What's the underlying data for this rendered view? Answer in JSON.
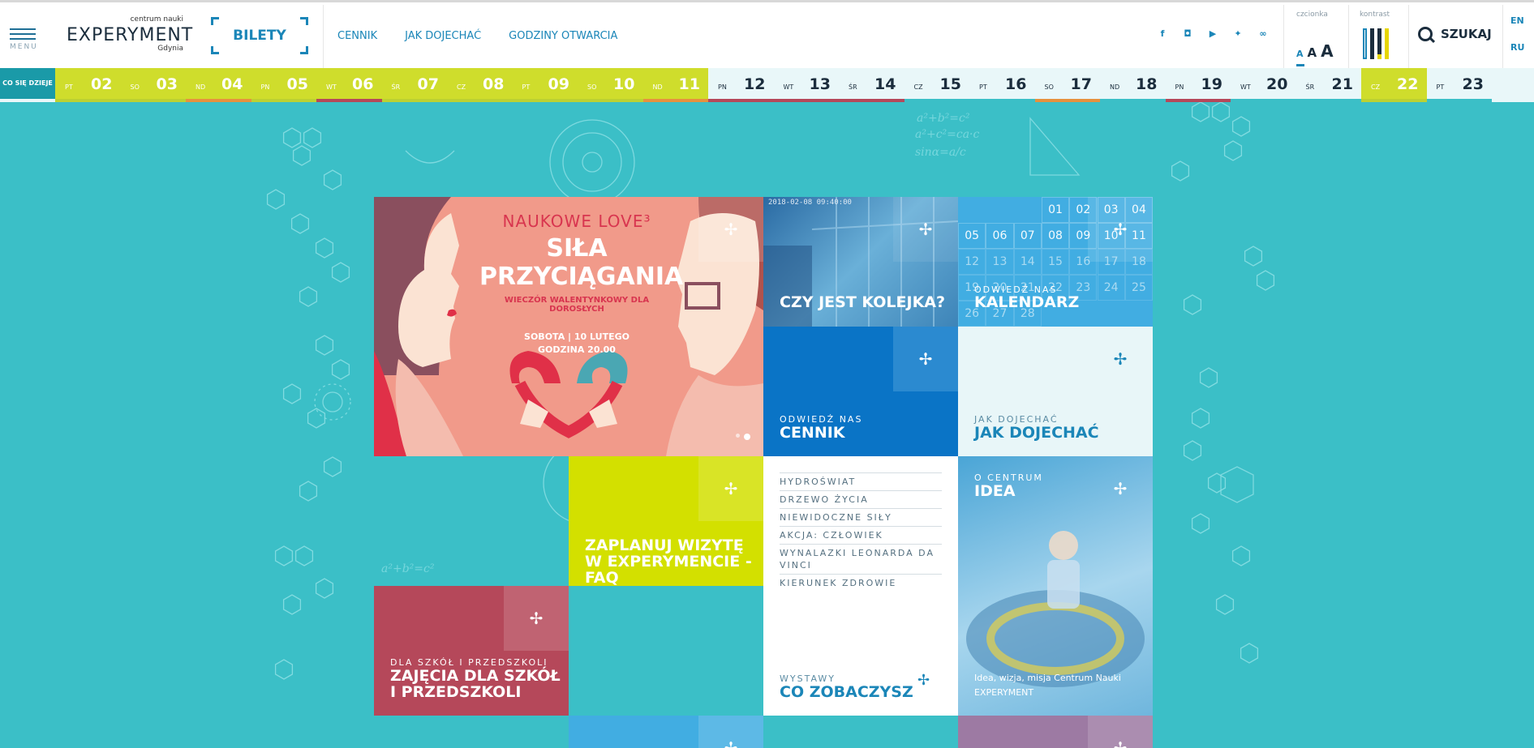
{
  "header": {
    "menu_label": "MENU",
    "logo": {
      "top": "centrum nauki",
      "main": "EXPERYMENT",
      "sub": "Gdynia"
    },
    "tickets": "BILETY",
    "nav": [
      "CENNIK",
      "JAK DOJECHAĆ",
      "GODZINY OTWARCIA"
    ],
    "social_icons": [
      "facebook-icon",
      "instagram-icon",
      "youtube-icon",
      "twitter-icon",
      "tripadvisor-icon"
    ],
    "font_label": "czcionka",
    "font_sizes": [
      "A",
      "A",
      "A"
    ],
    "contrast_label": "kontrast",
    "search_label": "SZUKAJ",
    "languages": [
      "EN",
      "RU"
    ]
  },
  "calendar": {
    "label": "CO SIĘ DZIEJE",
    "days": [
      {
        "name": "PT",
        "num": "02",
        "bg": "#cfdd2c",
        "color": "#ffffff",
        "stripe": "#bcd132"
      },
      {
        "name": "SO",
        "num": "03",
        "bg": "#cfdd2c",
        "color": "#ffffff",
        "stripe": "#bcd132"
      },
      {
        "name": "ND",
        "num": "04",
        "bg": "#cfdd2c",
        "color": "#ffffff",
        "stripe": "#e6913e"
      },
      {
        "name": "PN",
        "num": "05",
        "bg": "#cfdd2c",
        "color": "#ffffff",
        "stripe": "#bcd132"
      },
      {
        "name": "WT",
        "num": "06",
        "bg": "#cfdd2c",
        "color": "#ffffff",
        "stripe": "#b5485a"
      },
      {
        "name": "ŚR",
        "num": "07",
        "bg": "#cfdd2c",
        "color": "#ffffff",
        "stripe": "#bcd132"
      },
      {
        "name": "CZ",
        "num": "08",
        "bg": "#cfdd2c",
        "color": "#ffffff",
        "stripe": "#bcd132"
      },
      {
        "name": "PT",
        "num": "09",
        "bg": "#cfdd2c",
        "color": "#ffffff",
        "stripe": "#bcd132"
      },
      {
        "name": "SO",
        "num": "10",
        "bg": "#cfdd2c",
        "color": "#ffffff",
        "stripe": "#bcd132"
      },
      {
        "name": "ND",
        "num": "11",
        "bg": "#cfdd2c",
        "color": "#ffffff",
        "stripe": "#e6913e"
      },
      {
        "name": "PN",
        "num": "12",
        "bg": "#e9f7f9",
        "color": "#1b2d3d",
        "stripe": "#b5485a"
      },
      {
        "name": "WT",
        "num": "13",
        "bg": "#e9f7f9",
        "color": "#1b2d3d",
        "stripe": "#b5485a"
      },
      {
        "name": "ŚR",
        "num": "14",
        "bg": "#e9f7f9",
        "color": "#1b2d3d",
        "stripe": "#b5485a"
      },
      {
        "name": "CZ",
        "num": "15",
        "bg": "#e9f7f9",
        "color": "#1b2d3d",
        "stripe": "#3bbfc7"
      },
      {
        "name": "PT",
        "num": "16",
        "bg": "#e9f7f9",
        "color": "#1b2d3d",
        "stripe": "#3bbfc7"
      },
      {
        "name": "SO",
        "num": "17",
        "bg": "#e9f7f9",
        "color": "#1b2d3d",
        "stripe": "#e6913e"
      },
      {
        "name": "ND",
        "num": "18",
        "bg": "#e9f7f9",
        "color": "#1b2d3d",
        "stripe": "#3bbfc7"
      },
      {
        "name": "PN",
        "num": "19",
        "bg": "#e9f7f9",
        "color": "#1b2d3d",
        "stripe": "#b5485a"
      },
      {
        "name": "WT",
        "num": "20",
        "bg": "#e9f7f9",
        "color": "#1b2d3d",
        "stripe": "#3bbfc7"
      },
      {
        "name": "ŚR",
        "num": "21",
        "bg": "#e9f7f9",
        "color": "#1b2d3d",
        "stripe": "#3bbfc7"
      },
      {
        "name": "CZ",
        "num": "22",
        "bg": "#cfdd2c",
        "color": "#ffffff",
        "stripe": "#bcd132"
      },
      {
        "name": "PT",
        "num": "23",
        "bg": "#e9f7f9",
        "color": "#1b2d3d",
        "stripe": "#3bbfc7"
      }
    ]
  },
  "hero": {
    "line1": "NAUKOWE LOVE³",
    "line2": "SIŁA PRZYCIĄGANIA",
    "line3": "WIECZÓR WALENTYNKOWY DLA DOROSŁYCH",
    "line4": "SOBOTA | 10 LUTEGO",
    "line5": "GODZINA 20.00"
  },
  "tiles": {
    "queue": {
      "title": "CZY JEST KOLEJKA?",
      "timestamp": "2018-02-08 09:40:00"
    },
    "calendar": {
      "kicker": "ODWIEDŹ NAS",
      "title": "KALENDARZ",
      "days": [
        "01",
        "02",
        "03",
        "04",
        "05",
        "06",
        "07",
        "08",
        "09",
        "10",
        "11",
        "12",
        "13",
        "14",
        "15",
        "16",
        "17",
        "18",
        "19",
        "20",
        "21",
        "22",
        "23",
        "24",
        "25",
        "26",
        "27",
        "28"
      ]
    },
    "price": {
      "kicker": "ODWIEDŹ NAS",
      "title": "CENNIK"
    },
    "directions": {
      "kicker": "JAK DOJECHAĆ",
      "title": "JAK DOJECHAĆ"
    },
    "faq": {
      "title": "ZAPLANUJ WIZYTĘ W EXPERYMENCIE - FAQ"
    },
    "exhibitions": {
      "items": [
        "HYDROŚWIAT",
        "DRZEWO ŻYCIA",
        "NIEWIDOCZNE SIŁY",
        "AKCJA: CZŁOWIEK",
        "WYNALAZKI LEONARDA DA VINCI",
        "KIERUNEK ZDROWIE"
      ],
      "kicker": "WYSTAWY",
      "title": "CO ZOBACZYSZ"
    },
    "idea": {
      "kicker": "O CENTRUM",
      "title": "IDEA",
      "desc": "Idea, wizja, misja Centrum Nauki EXPERYMENT"
    },
    "schools": {
      "kicker": "DLA SZKÓŁ I PRZEDSZKOLI",
      "title": "ZAJĘCIA DLA SZKÓŁ I PRZEDSZKOLI"
    }
  },
  "colors": {
    "background": "#3bbfc7",
    "accent_blue": "#1b86b8",
    "lime": "#cfdd2c",
    "red": "#b5485a",
    "salmon": "#f19a8a",
    "dark_blue": "#0a74c6"
  }
}
